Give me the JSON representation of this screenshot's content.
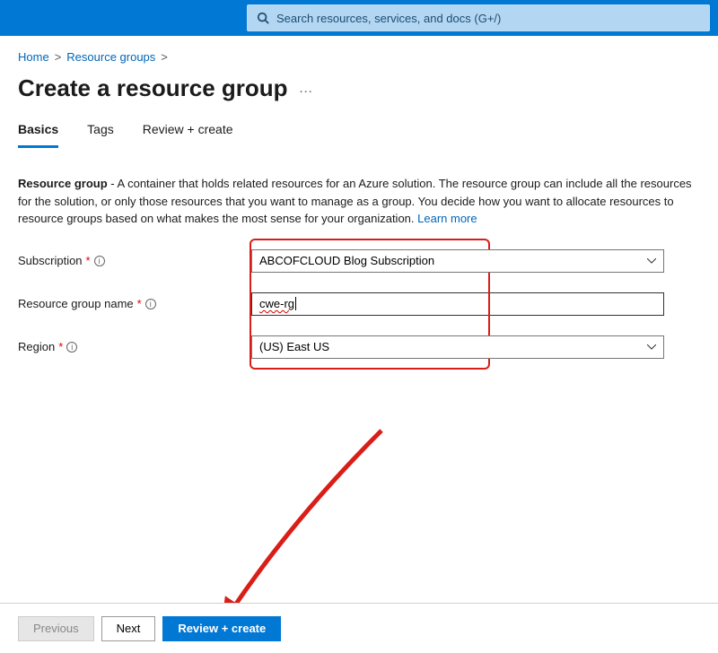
{
  "search": {
    "placeholder": "Search resources, services, and docs (G+/)"
  },
  "breadcrumb": {
    "home": "Home",
    "resource_groups": "Resource groups"
  },
  "page_title": "Create a resource group",
  "tabs": {
    "basics": "Basics",
    "tags": "Tags",
    "review_create": "Review + create"
  },
  "description": {
    "lead": "Resource group",
    "body": " - A container that holds related resources for an Azure solution. The resource group can include all the resources for the solution, or only those resources that you want to manage as a group. You decide how you want to allocate resources to resource groups based on what makes the most sense for your organization. ",
    "learn_more": "Learn more"
  },
  "form": {
    "subscription": {
      "label": "Subscription",
      "value": "ABCOFCLOUD Blog Subscription"
    },
    "resource_group_name": {
      "label": "Resource group name",
      "value": "cwe-rg"
    },
    "region": {
      "label": "Region",
      "value": "(US) East US"
    }
  },
  "footer": {
    "previous": "Previous",
    "next": "Next",
    "review_create": "Review + create"
  }
}
